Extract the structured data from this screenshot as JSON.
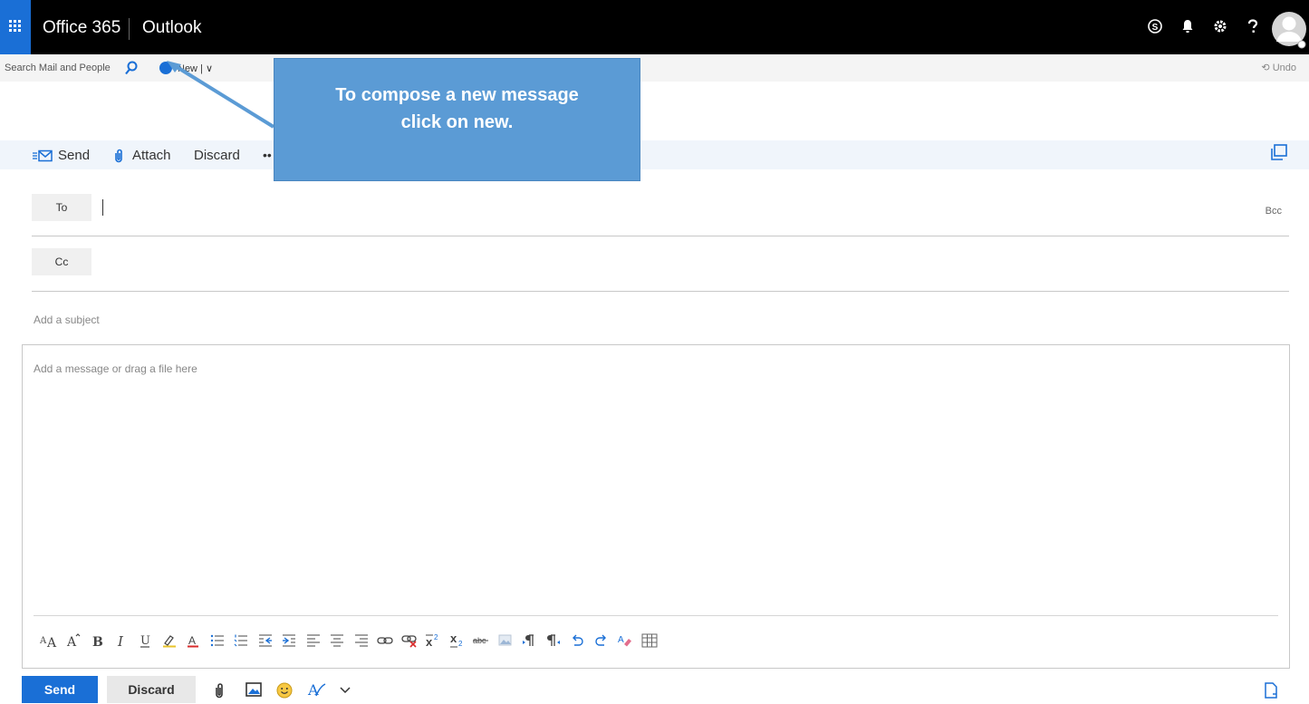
{
  "suite": {
    "title": "Office 365",
    "app": "Outlook"
  },
  "cmdbar": {
    "search_placeholder": "Search Mail and People",
    "new_label": "New | ∨",
    "undo_label": "⟲ Undo"
  },
  "toolbar": {
    "send": "Send",
    "attach": "Attach",
    "discard": "Discard",
    "more": "••"
  },
  "callout": {
    "line1": "To compose a new message",
    "line2": "click on new."
  },
  "compose": {
    "to_label": "To",
    "cc_label": "Cc",
    "bcc_label": "Bcc",
    "subject_placeholder": "Add a subject",
    "body_placeholder": "Add a message or drag a file here"
  },
  "bottom": {
    "send": "Send",
    "discard": "Discard"
  },
  "colors": {
    "accent": "#1a6fd6",
    "callout": "#5b9bd5",
    "topbar": "#000000"
  }
}
